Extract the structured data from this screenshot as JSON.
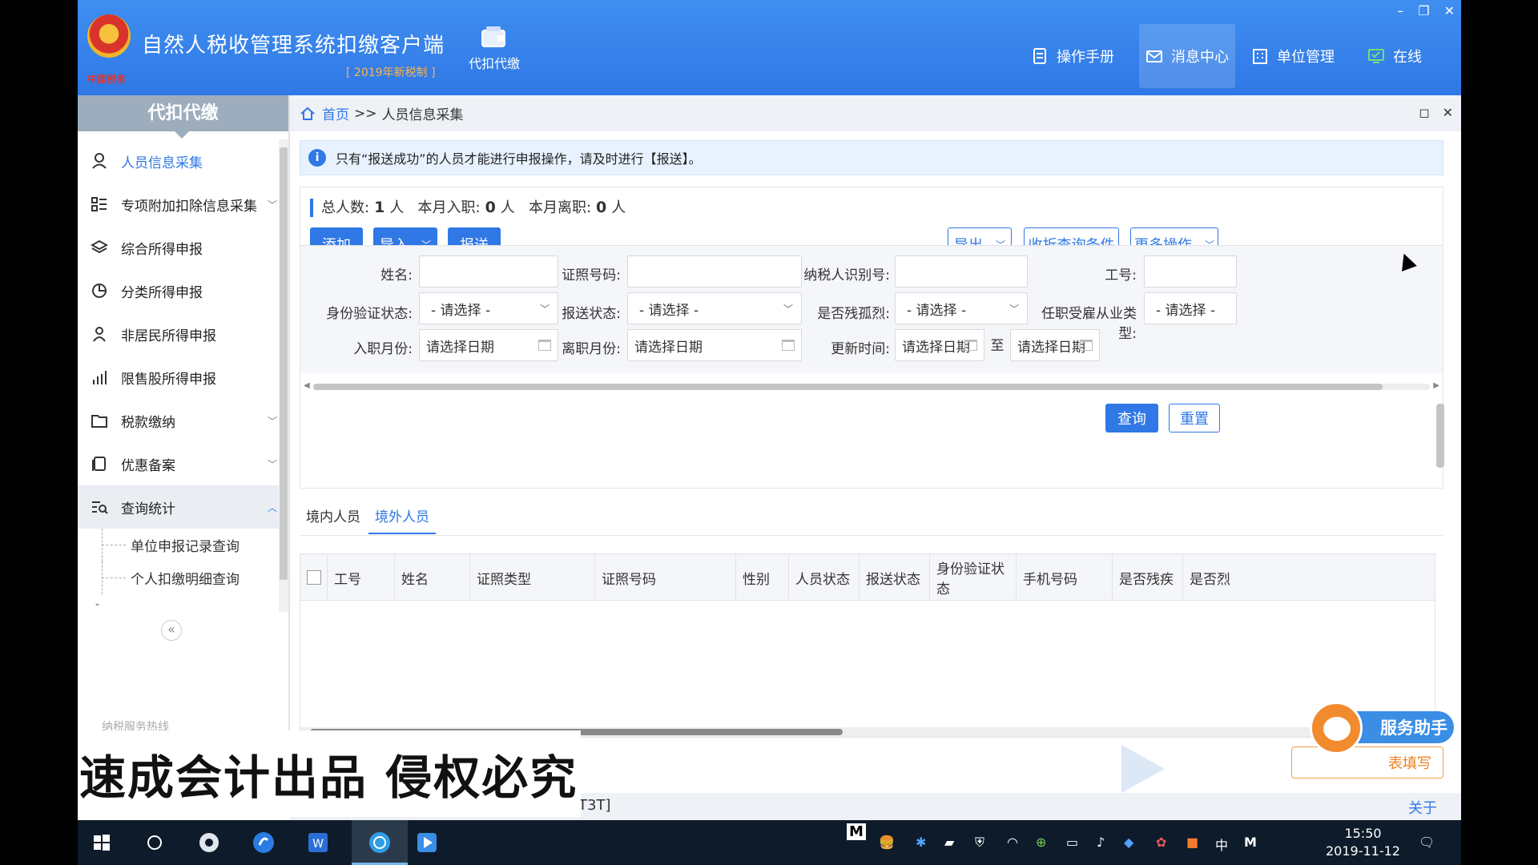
{
  "header": {
    "logo_caption": "中国税务",
    "title": "自然人税收管理系统扣缴客户端",
    "subtitle": "[ 2019年新税制 ]",
    "module_label": "代扣代缴",
    "nav": [
      {
        "label": "操作手册",
        "icon": "manual-icon"
      },
      {
        "label": "消息中心",
        "icon": "mail-icon"
      },
      {
        "label": "单位管理",
        "icon": "building-icon"
      },
      {
        "label": "在线",
        "icon": "monitor-icon"
      }
    ],
    "window_controls": [
      "–",
      "❐",
      "✕"
    ]
  },
  "sidebar": {
    "title": "代扣代缴",
    "items": [
      {
        "label": "人员信息采集",
        "icon": "person-icon"
      },
      {
        "label": "专项附加扣除信息采集",
        "icon": "list-icon"
      },
      {
        "label": "综合所得申报",
        "icon": "layers-icon"
      },
      {
        "label": "分类所得申报",
        "icon": "pie-icon"
      },
      {
        "label": "非居民所得申报",
        "icon": "user-icon"
      },
      {
        "label": "限售股所得申报",
        "icon": "bar-chart-icon"
      },
      {
        "label": "税款缴纳",
        "icon": "folder-icon"
      },
      {
        "label": "优惠备案",
        "icon": "copy-icon"
      },
      {
        "label": "查询统计",
        "icon": "search-list-icon"
      }
    ],
    "sub_items": [
      "单位申报记录查询",
      "个人扣缴明细查询"
    ],
    "dash": "-",
    "collapse": "«",
    "hotline": "纳税服务热线"
  },
  "breadcrumb": {
    "home": "首页",
    "sep": ">>",
    "current": "人员信息采集"
  },
  "crumb_controls": [
    "◻",
    "✕"
  ],
  "notice": {
    "icon": "i",
    "text": "只有“报送成功”的人员才能进行申报操作，请及时进行【报送】。"
  },
  "stats": {
    "total_label": "总人数:",
    "total_value": "1",
    "unit": "人",
    "join_label": "本月入职:",
    "join_value": "0",
    "leave_label": "本月离职:",
    "leave_value": "0"
  },
  "buttons": {
    "add": "添加",
    "import": "导入",
    "send": "报送",
    "export": "导出",
    "collapse_filter": "收折查询条件",
    "more": "更多操作",
    "query": "查询",
    "reset": "重置"
  },
  "filters": {
    "name_label": "姓名:",
    "id_no_label": "证照号码:",
    "taxpayer_id_label": "纳税人识别号:",
    "emp_no_label": "工号:",
    "verify_label": "身份验证状态:",
    "send_status_label": "报送状态:",
    "disabled_label": "是否残孤烈:",
    "employ_type_label": "任职受雇从业类型:",
    "select_placeholder": "- 请选择 -",
    "join_month_label": "入职月份:",
    "leave_month_label": "离职月份:",
    "update_time_label": "更新时间:",
    "date_placeholder": "请选择日期",
    "to": "至"
  },
  "tabs": [
    "境内人员",
    "境外人员"
  ],
  "table": {
    "columns": [
      "工号",
      "姓名",
      "证照类型",
      "证照号码",
      "性别",
      "人员状态",
      "报送状态",
      "身份验证状态",
      "手机号码",
      "是否残疾",
      "是否烈"
    ]
  },
  "statusbar": {
    "code": "T3T]",
    "close": "关于"
  },
  "helper": {
    "label": "服务助手",
    "sub": "表填写"
  },
  "watermark": "速成会计出品 侵权必究",
  "taskbar": {
    "clock_time": "15:50",
    "clock_date": "2019-11-12",
    "ime": "中",
    "m_label": "M"
  },
  "colors": {
    "primary": "#2f78e6",
    "header": "#3f8ef0",
    "sidebar_title": "#9dadbd"
  }
}
